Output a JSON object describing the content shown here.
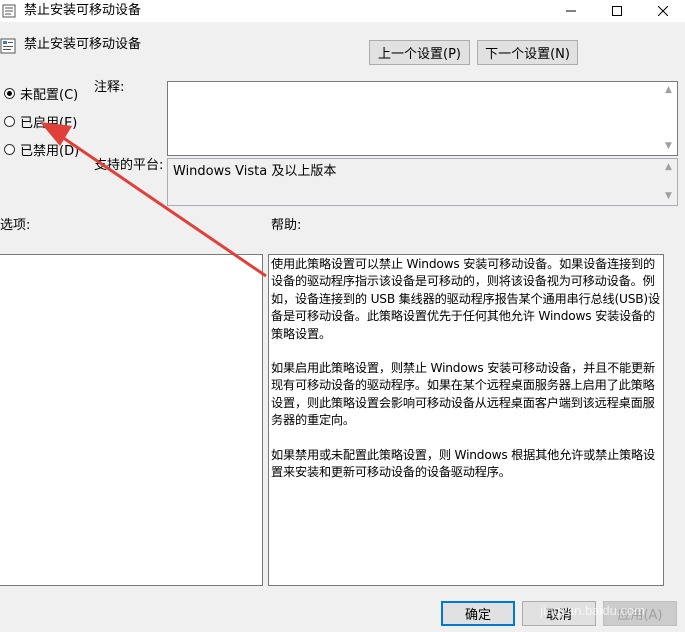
{
  "window": {
    "title": "禁止安装可移动设备",
    "controls": [
      "minimize-icon",
      "maximize-icon",
      "close-icon"
    ]
  },
  "header": {
    "policy_title": "禁止安装可移动设备",
    "prev_button": "上一个设置(P)",
    "next_button": "下一个设置(N)"
  },
  "state": {
    "options": [
      {
        "label": "未配置(C)",
        "checked": true
      },
      {
        "label": "已启用(E)",
        "checked": false
      },
      {
        "label": "已禁用(D)",
        "checked": false
      }
    ]
  },
  "comment": {
    "label": "注释:",
    "value": ""
  },
  "platform": {
    "label": "支持的平台:",
    "value": "Windows Vista 及以上版本"
  },
  "options_section": {
    "label": "选项:"
  },
  "help": {
    "label": "帮助:",
    "paragraphs": [
      "使用此策略设置可以禁止 Windows 安装可移动设备。如果设备连接到的设备的驱动程序指示该设备是可移动的，则将该设备视为可移动设备。例如，设备连接到的 USB 集线器的驱动程序报告某个通用串行总线(USB)设备是可移动设备。此策略设置优先于任何其他允许 Windows 安装设备的策略设置。",
      "如果启用此策略设置，则禁止 Windows 安装可移动设备，并且不能更新现有可移动设备的驱动程序。如果在某个远程桌面服务器上启用了此策略设置，则此策略设置会影响可移动设备从远程桌面客户端到该远程桌面服务器的重定向。",
      "如果禁用或未配置此策略设置，则 Windows 根据其他允许或禁止策略设置来安装和更新可移动设备的设备驱动程序。"
    ]
  },
  "footer": {
    "ok_button": "确定",
    "cancel_button": "取消",
    "apply_button": "应用(A)"
  },
  "annotation": {
    "arrow_color": "#e0403a"
  },
  "watermark": "jingyan.baidu.com"
}
